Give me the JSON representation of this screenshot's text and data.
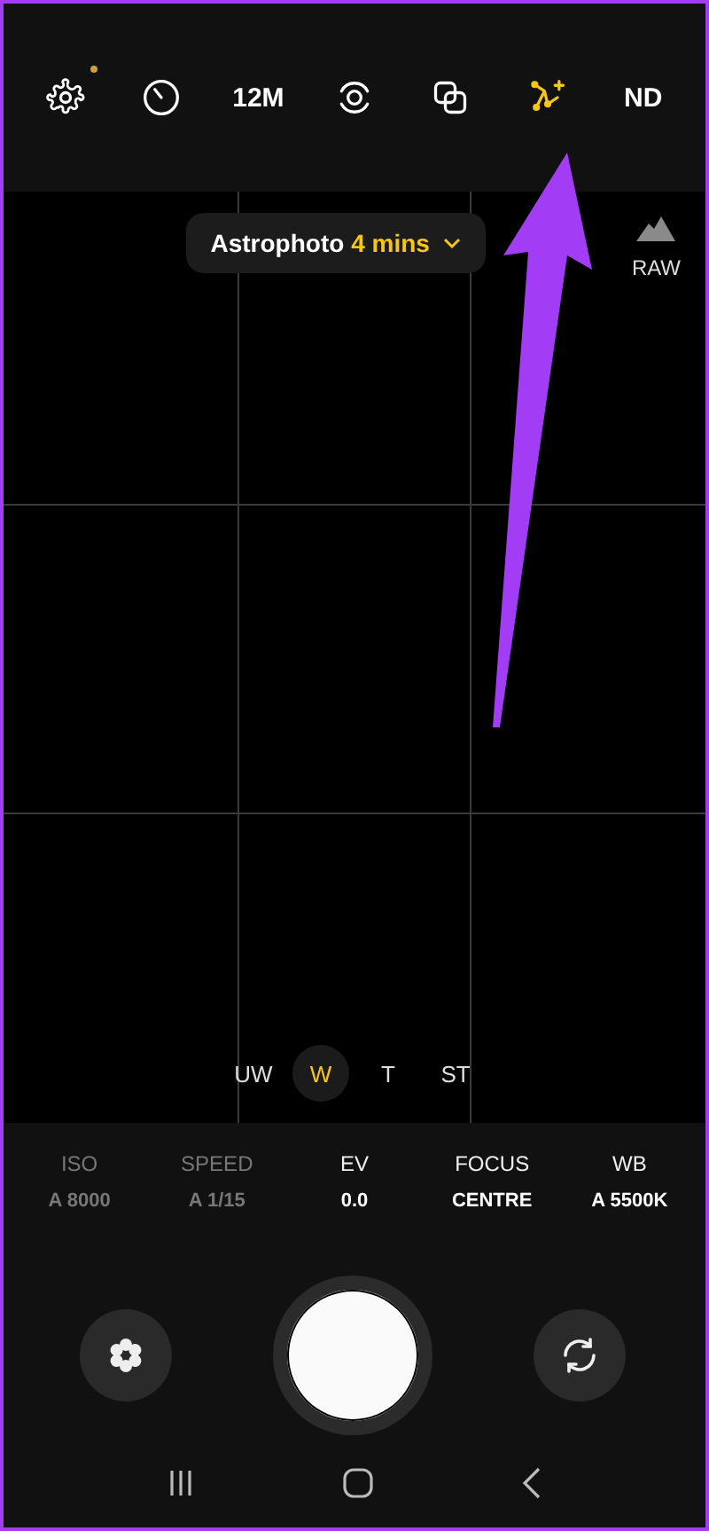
{
  "top_bar": [
    {
      "kind": "settings",
      "selected": false,
      "dot": true
    },
    {
      "kind": "timer",
      "selected": false,
      "dot": false
    },
    {
      "kind": "text",
      "label": "12M",
      "selected": false,
      "dot": false
    },
    {
      "kind": "motion",
      "selected": false,
      "dot": false
    },
    {
      "kind": "overlap",
      "selected": false,
      "dot": false
    },
    {
      "kind": "astro",
      "selected": true,
      "dot": false
    },
    {
      "kind": "text",
      "label": "ND",
      "selected": false,
      "dot": false
    }
  ],
  "mode": {
    "label": "Astrophoto",
    "duration": "4 mins"
  },
  "raw": {
    "label": "RAW"
  },
  "lenses": [
    {
      "label": "UW",
      "selected": false
    },
    {
      "label": "W",
      "selected": true
    },
    {
      "label": "T",
      "selected": false
    },
    {
      "label": "ST",
      "selected": false
    }
  ],
  "pro_settings": [
    {
      "label": "ISO",
      "value": "A 8000",
      "disabled": true
    },
    {
      "label": "SPEED",
      "value": "A 1/15",
      "disabled": true
    },
    {
      "label": "EV",
      "value": "0.0",
      "disabled": false
    },
    {
      "label": "FOCUS",
      "value": "CENTRE",
      "disabled": false
    },
    {
      "label": "WB",
      "value": "A 5500K",
      "disabled": false
    }
  ]
}
